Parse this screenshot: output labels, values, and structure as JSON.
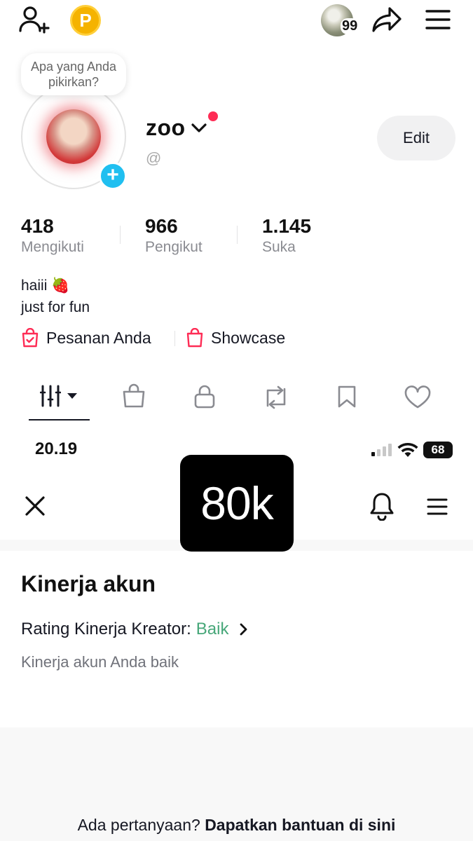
{
  "top_bar": {
    "coin_label": "P",
    "story_badge": "99",
    "icons": [
      "add-user-icon",
      "coin-icon",
      "story-avatar",
      "share-icon",
      "menu-icon"
    ]
  },
  "profile": {
    "thought_bubble": "Apa yang Anda pikirkan?",
    "username": "zoo",
    "handle": "@",
    "edit_label": "Edit",
    "stats": [
      {
        "value": "418",
        "label": "Mengikuti"
      },
      {
        "value": "966",
        "label": "Pengikut"
      },
      {
        "value": "1.145",
        "label": "Suka"
      }
    ],
    "bio_line1": "haiii 🍓",
    "bio_line2": "just for fun",
    "links": [
      {
        "label": "Pesanan Anda"
      },
      {
        "label": "Showcase"
      }
    ],
    "tabs": [
      "videos-grid-icon",
      "shop-bag-icon",
      "lock-icon",
      "repost-icon",
      "bookmark-icon",
      "heart-icon"
    ]
  },
  "status_bar": {
    "time": "20.19",
    "battery": "68"
  },
  "overlay": {
    "text": "80k"
  },
  "account": {
    "title": "Kinerja akun",
    "rating_label": "Rating Kinerja Kreator:",
    "rating_value": "Baik",
    "description": "Kinerja akun Anda baik",
    "help_prefix": "Ada pertanyaan?",
    "help_link": "Dapatkan bantuan di sini"
  },
  "colors": {
    "accent_red": "#fe2c55",
    "plus_blue": "#20bff0",
    "rating_green": "#47a779"
  }
}
